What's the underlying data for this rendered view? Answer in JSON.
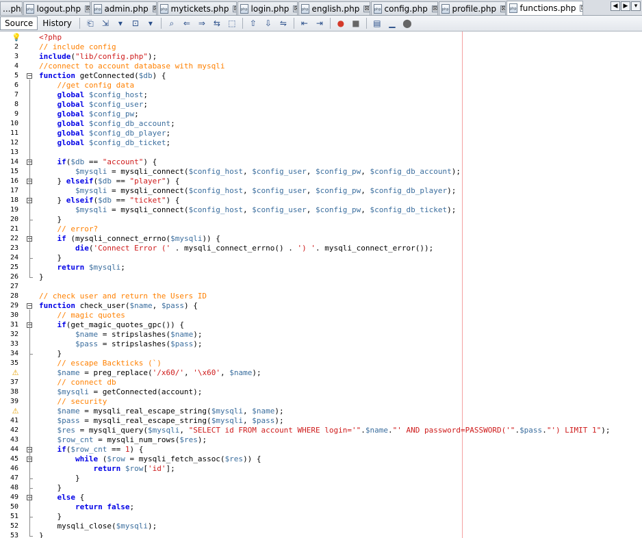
{
  "tabs": [
    {
      "label": "...php",
      "close": "⊠"
    },
    {
      "label": "logout.php",
      "close": "⊠"
    },
    {
      "label": "admin.php",
      "close": "⊠"
    },
    {
      "label": "mytickets.php",
      "close": "⊠"
    },
    {
      "label": "login.php",
      "close": "⊠"
    },
    {
      "label": "english.php",
      "close": "⊠"
    },
    {
      "label": "config.php",
      "close": "⊠"
    },
    {
      "label": "profile.php",
      "close": "⊠"
    },
    {
      "label": "functions.php",
      "close": "⊠"
    }
  ],
  "file_icon_text": "php",
  "tab_nav": [
    "◀",
    "▶",
    "▾"
  ],
  "toolbar": {
    "source_label": "Source",
    "history_label": "History",
    "icons": [
      "⎗",
      "⇲",
      "▾",
      "⊡",
      "▾",
      "⌕",
      "⇐",
      "⇒",
      "⇆",
      "⬚",
      "⇧",
      "⇩",
      "⇋",
      "⇤",
      "⇥",
      "●",
      "■",
      "▤",
      "▁",
      "⬤"
    ]
  },
  "colors": {
    "keyword": "#0000e6",
    "comment": "#ff8000",
    "string": "#ce1a1a",
    "variable": "#3b6e9e",
    "margin_line": "#f4a0a0"
  },
  "gutter_icons": {
    "bulb": "💡",
    "warn": "⚠"
  },
  "code_lines": [
    {
      "n": "1",
      "icon": "bulb",
      "segs": [
        [
          "st",
          "<?php"
        ]
      ]
    },
    {
      "n": "2",
      "segs": [
        [
          "cm",
          "// include config"
        ]
      ]
    },
    {
      "n": "3",
      "segs": [
        [
          "kw",
          "include"
        ],
        [
          "fn",
          "("
        ],
        [
          "st",
          "\"lib/config.php\""
        ],
        [
          "fn",
          ");"
        ]
      ]
    },
    {
      "n": "4",
      "segs": [
        [
          "cm",
          "//connect to account database with mysqli"
        ]
      ]
    },
    {
      "n": "5",
      "fold": "open",
      "segs": [
        [
          "kw",
          "function"
        ],
        [
          "fn",
          " getConnected("
        ],
        [
          "vr",
          "$db"
        ],
        [
          "fn",
          ") {"
        ]
      ]
    },
    {
      "n": "6",
      "segs": [
        [
          "fn",
          "    "
        ],
        [
          "cm",
          "//get config data"
        ]
      ]
    },
    {
      "n": "7",
      "segs": [
        [
          "fn",
          "    "
        ],
        [
          "kw",
          "global"
        ],
        [
          "fn",
          " "
        ],
        [
          "vr",
          "$config_host"
        ],
        [
          "fn",
          ";"
        ]
      ]
    },
    {
      "n": "8",
      "segs": [
        [
          "fn",
          "    "
        ],
        [
          "kw",
          "global"
        ],
        [
          "fn",
          " "
        ],
        [
          "vr",
          "$config_user"
        ],
        [
          "fn",
          ";"
        ]
      ]
    },
    {
      "n": "9",
      "segs": [
        [
          "fn",
          "    "
        ],
        [
          "kw",
          "global"
        ],
        [
          "fn",
          " "
        ],
        [
          "vr",
          "$config_pw"
        ],
        [
          "fn",
          ";"
        ]
      ]
    },
    {
      "n": "10",
      "segs": [
        [
          "fn",
          "    "
        ],
        [
          "kw",
          "global"
        ],
        [
          "fn",
          " "
        ],
        [
          "vr",
          "$config_db_account"
        ],
        [
          "fn",
          ";"
        ]
      ]
    },
    {
      "n": "11",
      "segs": [
        [
          "fn",
          "    "
        ],
        [
          "kw",
          "global"
        ],
        [
          "fn",
          " "
        ],
        [
          "vr",
          "$config_db_player"
        ],
        [
          "fn",
          ";"
        ]
      ]
    },
    {
      "n": "12",
      "segs": [
        [
          "fn",
          "    "
        ],
        [
          "kw",
          "global"
        ],
        [
          "fn",
          " "
        ],
        [
          "vr",
          "$config_db_ticket"
        ],
        [
          "fn",
          ";"
        ]
      ]
    },
    {
      "n": "13",
      "segs": [
        [
          "fn",
          ""
        ]
      ]
    },
    {
      "n": "14",
      "fold": "open",
      "segs": [
        [
          "fn",
          "    "
        ],
        [
          "kw",
          "if"
        ],
        [
          "fn",
          "("
        ],
        [
          "vr",
          "$db"
        ],
        [
          "fn",
          " == "
        ],
        [
          "st",
          "\"account\""
        ],
        [
          "fn",
          ") {"
        ]
      ]
    },
    {
      "n": "15",
      "segs": [
        [
          "fn",
          "        "
        ],
        [
          "vr",
          "$mysqli"
        ],
        [
          "fn",
          " = mysqli_connect("
        ],
        [
          "vr",
          "$config_host"
        ],
        [
          "fn",
          ", "
        ],
        [
          "vr",
          "$config_user"
        ],
        [
          "fn",
          ", "
        ],
        [
          "vr",
          "$config_pw"
        ],
        [
          "fn",
          ", "
        ],
        [
          "vr",
          "$config_db_account"
        ],
        [
          "fn",
          ");"
        ]
      ]
    },
    {
      "n": "16",
      "fold": "open",
      "segs": [
        [
          "fn",
          "    } "
        ],
        [
          "kw",
          "elseif"
        ],
        [
          "fn",
          "("
        ],
        [
          "vr",
          "$db"
        ],
        [
          "fn",
          " == "
        ],
        [
          "st",
          "\"player\""
        ],
        [
          "fn",
          ") {"
        ]
      ]
    },
    {
      "n": "17",
      "segs": [
        [
          "fn",
          "        "
        ],
        [
          "vr",
          "$mysqli"
        ],
        [
          "fn",
          " = mysqli_connect("
        ],
        [
          "vr",
          "$config_host"
        ],
        [
          "fn",
          ", "
        ],
        [
          "vr",
          "$config_user"
        ],
        [
          "fn",
          ", "
        ],
        [
          "vr",
          "$config_pw"
        ],
        [
          "fn",
          ", "
        ],
        [
          "vr",
          "$config_db_player"
        ],
        [
          "fn",
          ");"
        ]
      ]
    },
    {
      "n": "18",
      "fold": "open",
      "segs": [
        [
          "fn",
          "    } "
        ],
        [
          "kw",
          "elseif"
        ],
        [
          "fn",
          "("
        ],
        [
          "vr",
          "$db"
        ],
        [
          "fn",
          " == "
        ],
        [
          "st",
          "\"ticket\""
        ],
        [
          "fn",
          ") {"
        ]
      ]
    },
    {
      "n": "19",
      "segs": [
        [
          "fn",
          "        "
        ],
        [
          "vr",
          "$mysqli"
        ],
        [
          "fn",
          " = mysqli_connect("
        ],
        [
          "vr",
          "$config_host"
        ],
        [
          "fn",
          ", "
        ],
        [
          "vr",
          "$config_user"
        ],
        [
          "fn",
          ", "
        ],
        [
          "vr",
          "$config_pw"
        ],
        [
          "fn",
          ", "
        ],
        [
          "vr",
          "$config_db_ticket"
        ],
        [
          "fn",
          ");"
        ]
      ]
    },
    {
      "n": "20",
      "segs": [
        [
          "fn",
          "    }"
        ]
      ]
    },
    {
      "n": "21",
      "segs": [
        [
          "fn",
          "    "
        ],
        [
          "cm",
          "// error?"
        ]
      ]
    },
    {
      "n": "22",
      "fold": "open",
      "segs": [
        [
          "fn",
          "    "
        ],
        [
          "kw",
          "if"
        ],
        [
          "fn",
          " (mysqli_connect_errno("
        ],
        [
          "vr",
          "$mysqli"
        ],
        [
          "fn",
          ")) {"
        ]
      ]
    },
    {
      "n": "23",
      "segs": [
        [
          "fn",
          "        "
        ],
        [
          "kw",
          "die"
        ],
        [
          "fn",
          "("
        ],
        [
          "st",
          "'Connect Error ('"
        ],
        [
          "fn",
          " . mysqli_connect_errno() . "
        ],
        [
          "st",
          "') '"
        ],
        [
          "fn",
          ". mysqli_connect_error());"
        ]
      ]
    },
    {
      "n": "24",
      "segs": [
        [
          "fn",
          "    }"
        ]
      ]
    },
    {
      "n": "25",
      "segs": [
        [
          "fn",
          "    "
        ],
        [
          "kw",
          "return"
        ],
        [
          "fn",
          " "
        ],
        [
          "vr",
          "$mysqli"
        ],
        [
          "fn",
          ";"
        ]
      ]
    },
    {
      "n": "26",
      "segs": [
        [
          "fn",
          "}"
        ]
      ]
    },
    {
      "n": "27",
      "segs": [
        [
          "fn",
          ""
        ]
      ]
    },
    {
      "n": "28",
      "segs": [
        [
          "cm",
          "// check user and return the Users ID"
        ]
      ]
    },
    {
      "n": "29",
      "fold": "open",
      "segs": [
        [
          "kw",
          "function"
        ],
        [
          "fn",
          " check_user("
        ],
        [
          "vr",
          "$name"
        ],
        [
          "fn",
          ", "
        ],
        [
          "vr",
          "$pass"
        ],
        [
          "fn",
          ") {"
        ]
      ]
    },
    {
      "n": "30",
      "segs": [
        [
          "fn",
          "    "
        ],
        [
          "cm",
          "// magic quotes"
        ]
      ]
    },
    {
      "n": "31",
      "fold": "open",
      "segs": [
        [
          "fn",
          "    "
        ],
        [
          "kw",
          "if"
        ],
        [
          "fn",
          "(get_magic_quotes_gpc()) {"
        ]
      ]
    },
    {
      "n": "32",
      "segs": [
        [
          "fn",
          "        "
        ],
        [
          "vr",
          "$name"
        ],
        [
          "fn",
          " = stripslashes("
        ],
        [
          "vr",
          "$name"
        ],
        [
          "fn",
          ");"
        ]
      ]
    },
    {
      "n": "33",
      "segs": [
        [
          "fn",
          "        "
        ],
        [
          "vr",
          "$pass"
        ],
        [
          "fn",
          " = stripslashes("
        ],
        [
          "vr",
          "$pass"
        ],
        [
          "fn",
          ");"
        ]
      ]
    },
    {
      "n": "34",
      "segs": [
        [
          "fn",
          "    }"
        ]
      ]
    },
    {
      "n": "35",
      "segs": [
        [
          "fn",
          "    "
        ],
        [
          "cm",
          "// escape Backticks (`)"
        ]
      ]
    },
    {
      "n": "36",
      "icon": "warn",
      "segs": [
        [
          "fn",
          "    "
        ],
        [
          "vr",
          "$name"
        ],
        [
          "fn",
          " = preg_replace("
        ],
        [
          "st",
          "'/x60/'"
        ],
        [
          "fn",
          ", "
        ],
        [
          "st",
          "'\\x60'"
        ],
        [
          "fn",
          ", "
        ],
        [
          "vr",
          "$name"
        ],
        [
          "fn",
          ");"
        ]
      ]
    },
    {
      "n": "37",
      "segs": [
        [
          "fn",
          "    "
        ],
        [
          "cm",
          "// connect db"
        ]
      ]
    },
    {
      "n": "38",
      "segs": [
        [
          "fn",
          "    "
        ],
        [
          "vr",
          "$mysqli"
        ],
        [
          "fn",
          " = getConnected(account);"
        ]
      ]
    },
    {
      "n": "39",
      "segs": [
        [
          "fn",
          "    "
        ],
        [
          "cm",
          "// security"
        ]
      ]
    },
    {
      "n": "40",
      "icon": "warn",
      "segs": [
        [
          "fn",
          "    "
        ],
        [
          "vr",
          "$name"
        ],
        [
          "fn",
          " = mysqli_real_escape_string("
        ],
        [
          "vr",
          "$mysqli"
        ],
        [
          "fn",
          ", "
        ],
        [
          "vr",
          "$name"
        ],
        [
          "fn",
          ");"
        ]
      ]
    },
    {
      "n": "41",
      "segs": [
        [
          "fn",
          "    "
        ],
        [
          "vr",
          "$pass"
        ],
        [
          "fn",
          " = mysqli_real_escape_string("
        ],
        [
          "vr",
          "$mysqli"
        ],
        [
          "fn",
          ", "
        ],
        [
          "vr",
          "$pass"
        ],
        [
          "fn",
          ");"
        ]
      ]
    },
    {
      "n": "42",
      "segs": [
        [
          "fn",
          "    "
        ],
        [
          "vr",
          "$res"
        ],
        [
          "fn",
          " = mysqli_query("
        ],
        [
          "vr",
          "$mysqli"
        ],
        [
          "fn",
          ", "
        ],
        [
          "st",
          "\"SELECT id FROM account WHERE login='\""
        ],
        [
          "fn",
          "."
        ],
        [
          "vr",
          "$name"
        ],
        [
          "fn",
          "."
        ],
        [
          "st",
          "\"' AND password=PASSWORD('\""
        ],
        [
          "fn",
          "."
        ],
        [
          "vr",
          "$pass"
        ],
        [
          "fn",
          "."
        ],
        [
          "st",
          "\"') LIMIT 1\""
        ],
        [
          "fn",
          ");"
        ]
      ]
    },
    {
      "n": "43",
      "segs": [
        [
          "fn",
          "    "
        ],
        [
          "vr",
          "$row_cnt"
        ],
        [
          "fn",
          " = mysqli_num_rows("
        ],
        [
          "vr",
          "$res"
        ],
        [
          "fn",
          ");"
        ]
      ]
    },
    {
      "n": "44",
      "fold": "open",
      "segs": [
        [
          "fn",
          "    "
        ],
        [
          "kw",
          "if"
        ],
        [
          "fn",
          "("
        ],
        [
          "vr",
          "$row_cnt"
        ],
        [
          "fn",
          " == "
        ],
        [
          "st",
          "1"
        ],
        [
          "fn",
          ") {"
        ]
      ]
    },
    {
      "n": "45",
      "fold": "open",
      "segs": [
        [
          "fn",
          "        "
        ],
        [
          "kw",
          "while"
        ],
        [
          "fn",
          " ("
        ],
        [
          "vr",
          "$row"
        ],
        [
          "fn",
          " = mysqli_fetch_assoc("
        ],
        [
          "vr",
          "$res"
        ],
        [
          "fn",
          ")) {"
        ]
      ]
    },
    {
      "n": "46",
      "segs": [
        [
          "fn",
          "            "
        ],
        [
          "kw",
          "return"
        ],
        [
          "fn",
          " "
        ],
        [
          "vr",
          "$row"
        ],
        [
          "fn",
          "["
        ],
        [
          "st",
          "'id'"
        ],
        [
          "fn",
          "];"
        ]
      ]
    },
    {
      "n": "47",
      "segs": [
        [
          "fn",
          "        }"
        ]
      ]
    },
    {
      "n": "48",
      "segs": [
        [
          "fn",
          "    }"
        ]
      ]
    },
    {
      "n": "49",
      "fold": "open",
      "segs": [
        [
          "fn",
          "    "
        ],
        [
          "kw",
          "else"
        ],
        [
          "fn",
          " {"
        ]
      ]
    },
    {
      "n": "50",
      "segs": [
        [
          "fn",
          "        "
        ],
        [
          "kw",
          "return"
        ],
        [
          "fn",
          " "
        ],
        [
          "kw",
          "false"
        ],
        [
          "fn",
          ";"
        ]
      ]
    },
    {
      "n": "51",
      "segs": [
        [
          "fn",
          "    }"
        ]
      ]
    },
    {
      "n": "52",
      "segs": [
        [
          "fn",
          "    mysqli_close("
        ],
        [
          "vr",
          "$mysqli"
        ],
        [
          "fn",
          ");"
        ]
      ]
    },
    {
      "n": "53",
      "segs": [
        [
          "fn",
          "}"
        ]
      ]
    }
  ]
}
